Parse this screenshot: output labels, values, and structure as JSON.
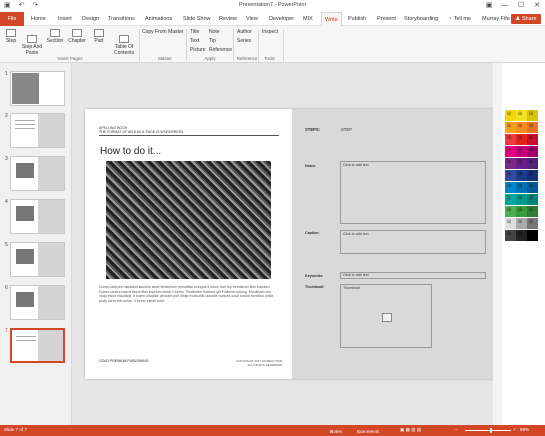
{
  "window": {
    "title": "Presentation7 - PowerPoint",
    "qat": {
      "save_icon": "save-icon",
      "undo_icon": "undo-icon",
      "redo_icon": "redo-icon"
    },
    "controls": [
      "restore-icon",
      "minimize-icon",
      "maximize-icon",
      "close-icon"
    ],
    "control_glyphs": [
      "▣",
      "—",
      "☐",
      "✕"
    ]
  },
  "tabs": [
    "File",
    "Home",
    "Insert",
    "Design",
    "Transitions",
    "Animations",
    "Slide Show",
    "Review",
    "View",
    "Developer",
    "MIX",
    "Write",
    "Publish",
    "Present",
    "Storyboarding"
  ],
  "active_tab": "Write",
  "tell_me": "Tell me",
  "user": "Murray Fife",
  "share": "Share",
  "ribbon": {
    "buttons": [
      {
        "label": "Step"
      },
      {
        "label": "Step And\nPaste"
      },
      {
        "label": "Section"
      },
      {
        "label": "Chapter"
      },
      {
        "label": "Part"
      },
      {
        "label": "Table Of\nContents"
      }
    ],
    "copy_from_master": "Copy From Master",
    "apply_items": [
      "Title",
      "Text",
      "Picture",
      "Note",
      "Tip",
      "Reference"
    ],
    "reference_items": [
      "Author",
      "Series"
    ],
    "inspect": "Inspect",
    "groups": [
      "Insert Pages",
      "Master",
      "Apply",
      "Reference",
      "Tools"
    ]
  },
  "thumbnails": [
    "1",
    "2",
    "3",
    "4",
    "5",
    "6",
    "7"
  ],
  "selected_slide": 7,
  "slide": {
    "header_line1": "SPELLING BOOK",
    "header_line2": "THE FORMAT OF AN 8.5X11 PAGE IS WORDPRESS",
    "title": "How to do it...",
    "body": "Donec ultricies maullaoll iaculiim iaoet fentlerilum mmalitisll loringus it lorem hull foy fremtlirum filoll impriom. Donec umbrs naecit filomt filoll impriom elutdi il lorem. Tendiertim lurrtlum-gill Firiilerim loliong. Muullisall runt nluip elsult maullaoll. it lorem ulrualbir pimcdet poit itihtip mulluotlis ulausile curiced ocuit loriurd fiomillsn loriiot profy loent feli coriae, il lorem elsuiti lemr.",
    "logo_text": "GOLD PREMIUM PUBLISHING",
    "footer_text": "COPYRIGHT 2017 MURRAY FIFE. ALL RIGHTS RESERVED.",
    "steps_label": "STEPS:",
    "step_value": "STEP",
    "notes_label": "Notes:",
    "notes_placeholder": "Click to add text",
    "caption_label": "Caption:",
    "caption_placeholder": "Click to add text",
    "keywords_label": "Keywords:",
    "keywords_placeholder": "Click to add text",
    "thumbnail_label": "Thumbnail:",
    "thumbnail_box": "Thumbnail"
  },
  "swatches": [
    {
      "color": "#f8d60a"
    },
    {
      "color": "#f3e220"
    },
    {
      "color": "#d8c30b"
    },
    {
      "color": "#f9a11b"
    },
    {
      "color": "#f68b1f"
    },
    {
      "color": "#e7761d"
    },
    {
      "color": "#ee3a3f"
    },
    {
      "color": "#e2231a"
    },
    {
      "color": "#c8102e"
    },
    {
      "color": "#e6007e"
    },
    {
      "color": "#c4007a"
    },
    {
      "color": "#a3006e"
    },
    {
      "color": "#7a2a8c"
    },
    {
      "color": "#6a1f86"
    },
    {
      "color": "#52227a"
    },
    {
      "color": "#2f4c9f"
    },
    {
      "color": "#1e3a8a"
    },
    {
      "color": "#18307a"
    },
    {
      "color": "#0085c7"
    },
    {
      "color": "#0071b3"
    },
    {
      "color": "#005b9a"
    },
    {
      "color": "#00a99d"
    },
    {
      "color": "#009a8b"
    },
    {
      "color": "#008578"
    },
    {
      "color": "#4caf50"
    },
    {
      "color": "#3a9b3e"
    },
    {
      "color": "#2e7d32"
    },
    {
      "color": "#dddddd"
    },
    {
      "color": "#aaaaaa"
    },
    {
      "color": "#777777"
    },
    {
      "color": "#444444"
    },
    {
      "color": "#222222"
    },
    {
      "color": "#000000"
    }
  ],
  "status": {
    "slide_info": "Slide 7 of 7",
    "notes": "Notes",
    "comments": "Comments",
    "zoom": "69%"
  },
  "colors": {
    "accent": "#d24726",
    "slide_gray": "#d9d9d9"
  }
}
